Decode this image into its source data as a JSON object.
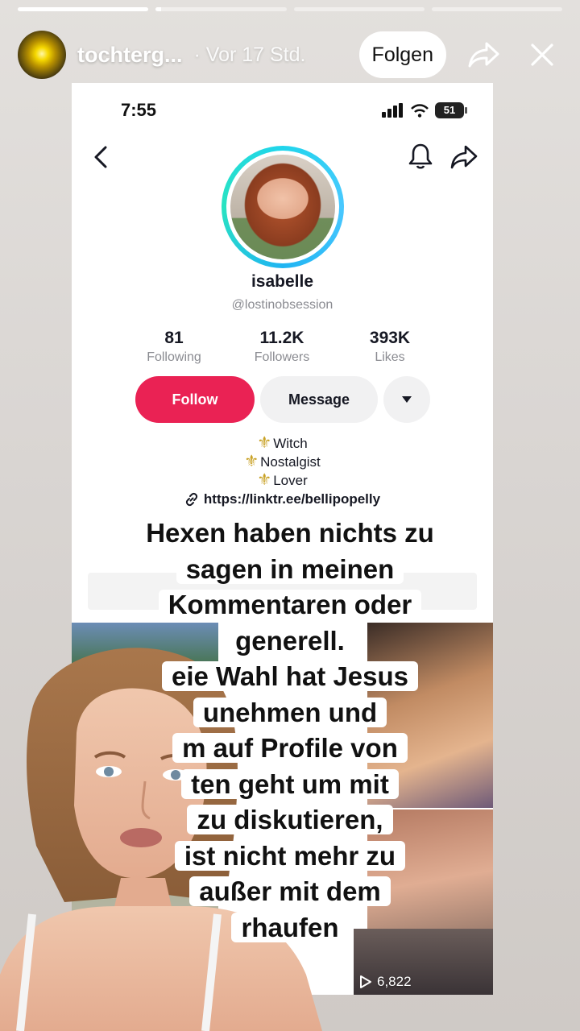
{
  "story": {
    "progress": [
      1,
      0.04,
      0,
      0
    ],
    "username": "tochterg...",
    "time": "· Vor 17 Std.",
    "follow_label": "Folgen",
    "icons": [
      "share-icon",
      "close-icon"
    ]
  },
  "screenshot": {
    "status_time": "7:55",
    "battery": "51",
    "profile": {
      "name": "isabelle",
      "handle": "@lostinobsession",
      "stats": [
        {
          "value": "81",
          "label": "Following"
        },
        {
          "value": "11.2K",
          "label": "Followers"
        },
        {
          "value": "393K",
          "label": "Likes"
        }
      ],
      "follow_label": "Follow",
      "message_label": "Message",
      "bio": [
        "Witch",
        "Nostalgist",
        "Lover"
      ],
      "link": "https://linktr.ee/bellipopelly"
    },
    "view_count": "6,822"
  },
  "caption": {
    "lines": [
      "Hexen haben nichts zu",
      "sagen in meinen",
      "Kommentaren oder",
      "generell.",
      "eie Wahl hat Jesus",
      "unehmen und",
      "m auf Profile von",
      "ten geht um mit",
      "zu diskutieren,",
      "ist nicht mehr zu",
      "außer mit dem",
      "rhaufen"
    ]
  },
  "colors": {
    "follow": "#ea2254",
    "ring": "#20d5ec"
  }
}
